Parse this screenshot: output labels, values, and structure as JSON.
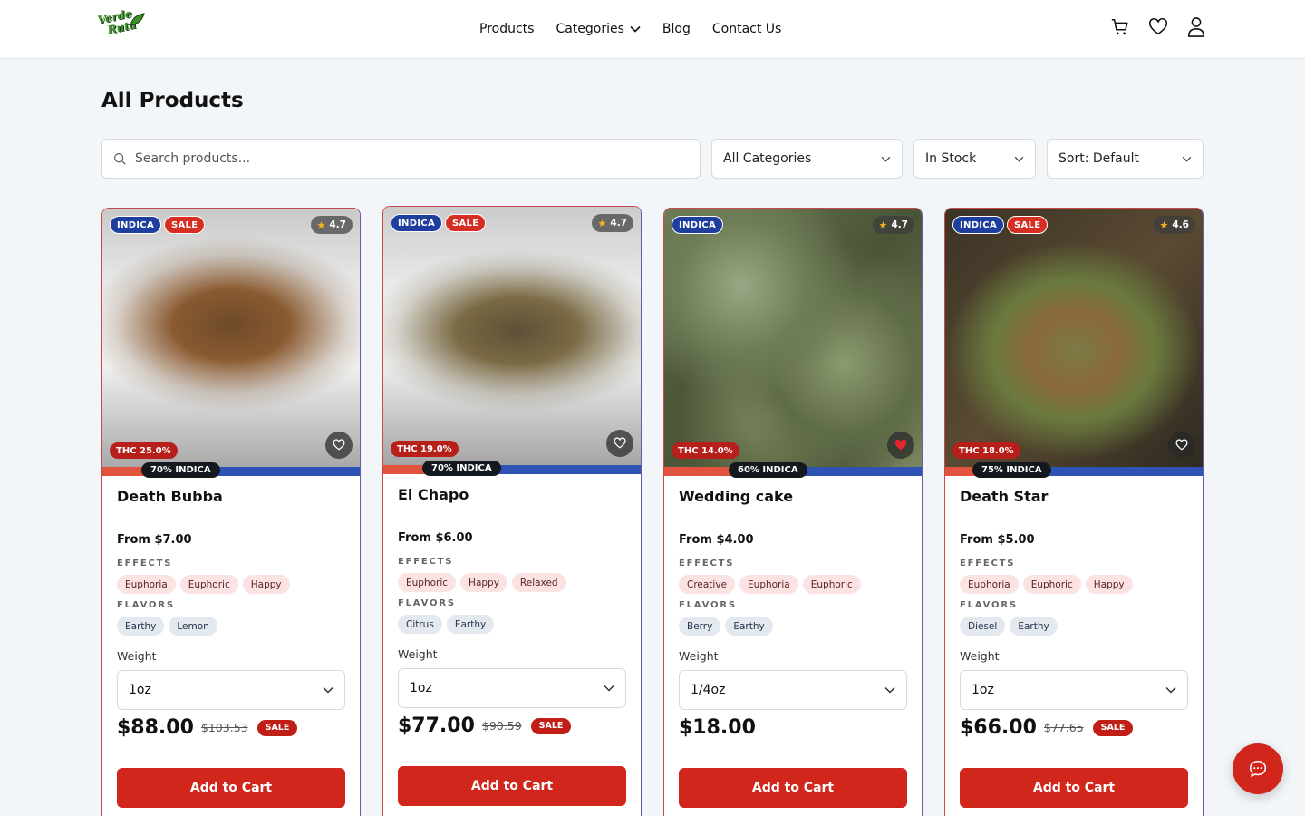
{
  "brand": {
    "logo_text_1": "Verde",
    "logo_text_2": "Ruta"
  },
  "nav": {
    "items": [
      {
        "label": "Products"
      },
      {
        "label": "Categories"
      },
      {
        "label": "Blog"
      },
      {
        "label": "Contact Us"
      }
    ]
  },
  "header_icons": [
    "cart-icon",
    "heart-icon",
    "user-icon"
  ],
  "page": {
    "title": "All Products"
  },
  "filters": {
    "search_placeholder": "Search products...",
    "category": "All Categories",
    "stock": "In Stock",
    "sort": "Sort: Default"
  },
  "labels": {
    "effects": "EFFECTS",
    "flavors": "FLAVORS",
    "weight": "Weight",
    "add_to_cart": "Add to Cart",
    "sale": "SALE",
    "from_prefix": "From"
  },
  "colors": {
    "accent_red": "#d0261c",
    "indica_blue": "#1f3f9e",
    "sativa_red": "#e0533c",
    "favorited": "#e4262c"
  },
  "products": [
    {
      "name": "Death Bubba",
      "strain": "INDICA",
      "on_sale": true,
      "rating": "4.7",
      "thc": "THC 25.0%",
      "ratio_label": "70% INDICA",
      "indica_pct": 70,
      "from_price": "From $7.00",
      "effects": [
        "Euphoria",
        "Euphoric",
        "Happy"
      ],
      "flavors": [
        "Earthy",
        "Lemon"
      ],
      "weight": "1oz",
      "price": "$88.00",
      "old_price": "$103.53",
      "favorited": false
    },
    {
      "name": "El Chapo",
      "strain": "INDICA",
      "on_sale": true,
      "rating": "4.7",
      "thc": "THC 19.0%",
      "ratio_label": "70% INDICA",
      "indica_pct": 70,
      "from_price": "From $6.00",
      "effects": [
        "Euphoric",
        "Happy",
        "Relaxed"
      ],
      "flavors": [
        "Citrus",
        "Earthy"
      ],
      "weight": "1oz",
      "price": "$77.00",
      "old_price": "$90.59",
      "favorited": false
    },
    {
      "name": "Wedding cake",
      "strain": "INDICA",
      "on_sale": false,
      "rating": "4.7",
      "thc": "THC 14.0%",
      "ratio_label": "60% INDICA",
      "indica_pct": 60,
      "from_price": "From $4.00",
      "effects": [
        "Creative",
        "Euphoria",
        "Euphoric"
      ],
      "flavors": [
        "Berry",
        "Earthy"
      ],
      "weight": "1/4oz",
      "price": "$18.00",
      "old_price": "",
      "favorited": true
    },
    {
      "name": "Death Star",
      "strain": "INDICA",
      "on_sale": true,
      "rating": "4.6",
      "thc": "THC 18.0%",
      "ratio_label": "75% INDICA",
      "indica_pct": 75,
      "from_price": "From $5.00",
      "effects": [
        "Euphoria",
        "Euphoric",
        "Happy"
      ],
      "flavors": [
        "Diesel",
        "Earthy"
      ],
      "weight": "1oz",
      "price": "$66.00",
      "old_price": "$77.65",
      "favorited": false
    }
  ]
}
